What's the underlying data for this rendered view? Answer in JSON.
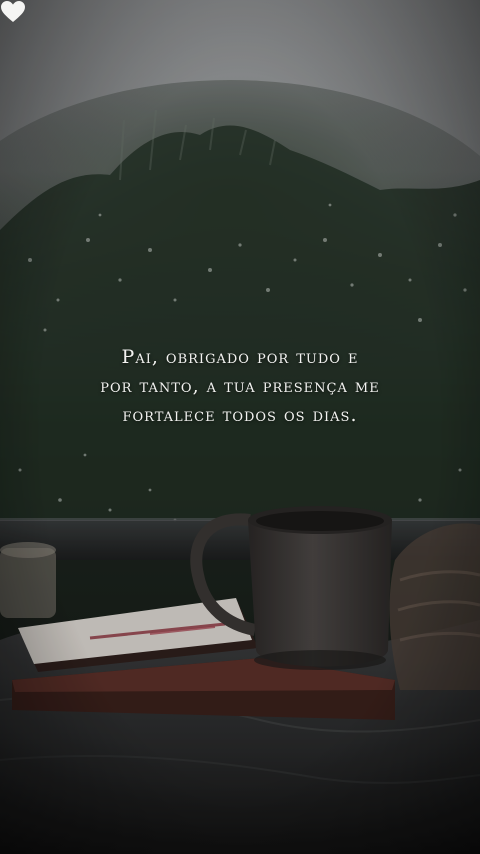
{
  "quote": {
    "lines": [
      "Pai, obrigado por tudo e",
      "por tanto, a tua presença me",
      "fortalece todos os dias."
    ]
  },
  "icons": {
    "heart": "heart-icon"
  },
  "colors": {
    "text": "#f2f2f0",
    "heart": "#f5f5f3",
    "sky": "#9a9c9e",
    "foliage": "#2a3a2c",
    "mug": "#3d3a38",
    "book": "#5a2f28"
  }
}
